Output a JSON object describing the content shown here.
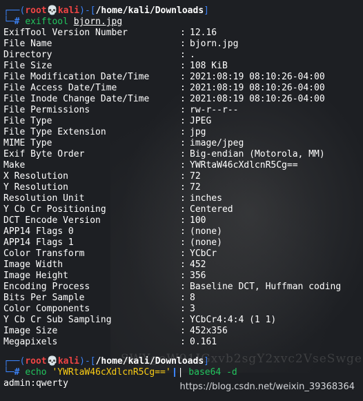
{
  "prompt1": {
    "frame_open": "┌──(",
    "user": "root",
    "skull": "💀",
    "host": "kali",
    "frame_mid": ")-[",
    "path": "/home/kali/Downloads",
    "frame_close": "]",
    "prefix": "└─",
    "hash": "#",
    "command": "exiftool",
    "arg": "bjorn.jpg"
  },
  "exif": [
    {
      "key": "ExifTool Version Number",
      "value": "12.16"
    },
    {
      "key": "File Name",
      "value": "bjorn.jpg"
    },
    {
      "key": "Directory",
      "value": "."
    },
    {
      "key": "File Size",
      "value": "108 KiB"
    },
    {
      "key": "File Modification Date/Time",
      "value": "2021:08:19 08:10:26-04:00"
    },
    {
      "key": "File Access Date/Time",
      "value": "2021:08:19 08:10:26-04:00"
    },
    {
      "key": "File Inode Change Date/Time",
      "value": "2021:08:19 08:10:26-04:00"
    },
    {
      "key": "File Permissions",
      "value": "rw-r--r--"
    },
    {
      "key": "File Type",
      "value": "JPEG"
    },
    {
      "key": "File Type Extension",
      "value": "jpg"
    },
    {
      "key": "MIME Type",
      "value": "image/jpeg"
    },
    {
      "key": "Exif Byte Order",
      "value": "Big-endian (Motorola, MM)"
    },
    {
      "key": "Make",
      "value": "YWRtaW46cXdlcnR5Cg=="
    },
    {
      "key": "X Resolution",
      "value": "72"
    },
    {
      "key": "Y Resolution",
      "value": "72"
    },
    {
      "key": "Resolution Unit",
      "value": "inches"
    },
    {
      "key": "Y Cb Cr Positioning",
      "value": "Centered"
    },
    {
      "key": "DCT Encode Version",
      "value": "100"
    },
    {
      "key": "APP14 Flags 0",
      "value": "(none)"
    },
    {
      "key": "APP14 Flags 1",
      "value": "(none)"
    },
    {
      "key": "Color Transform",
      "value": "YCbCr"
    },
    {
      "key": "Image Width",
      "value": "452"
    },
    {
      "key": "Image Height",
      "value": "356"
    },
    {
      "key": "Encoding Process",
      "value": "Baseline DCT, Huffman coding"
    },
    {
      "key": "Bits Per Sample",
      "value": "8"
    },
    {
      "key": "Color Components",
      "value": "3"
    },
    {
      "key": "Y Cb Cr Sub Sampling",
      "value": "YCbCr4:4:4 (1 1)"
    },
    {
      "key": "Image Size",
      "value": "452x356"
    },
    {
      "key": "Megapixels",
      "value": "0.161"
    }
  ],
  "separator": ":",
  "prompt2": {
    "frame_open": "┌──(",
    "user": "root",
    "skull": "💀",
    "host": "kali",
    "frame_mid": ")-[",
    "path": "/home/kali/Downloads",
    "frame_close": "]",
    "prefix": "└─",
    "hash": "#",
    "command": "echo",
    "string": "'YWRtaW46cXdlcnR5Cg=='",
    "pipe": "|",
    "command2": "base64",
    "flag": "-d"
  },
  "output": "admin:qwerty",
  "background_text": "SWYgeW91IGxvb2sgY2xvc2VseSwge",
  "watermark": "https://blog.csdn.net/weixin_39368364",
  "colors": {
    "frame": "#3b82f6",
    "user_host": "#ef4444",
    "command": "#22c55e",
    "string": "#facc15",
    "background": "#1d1f23"
  }
}
